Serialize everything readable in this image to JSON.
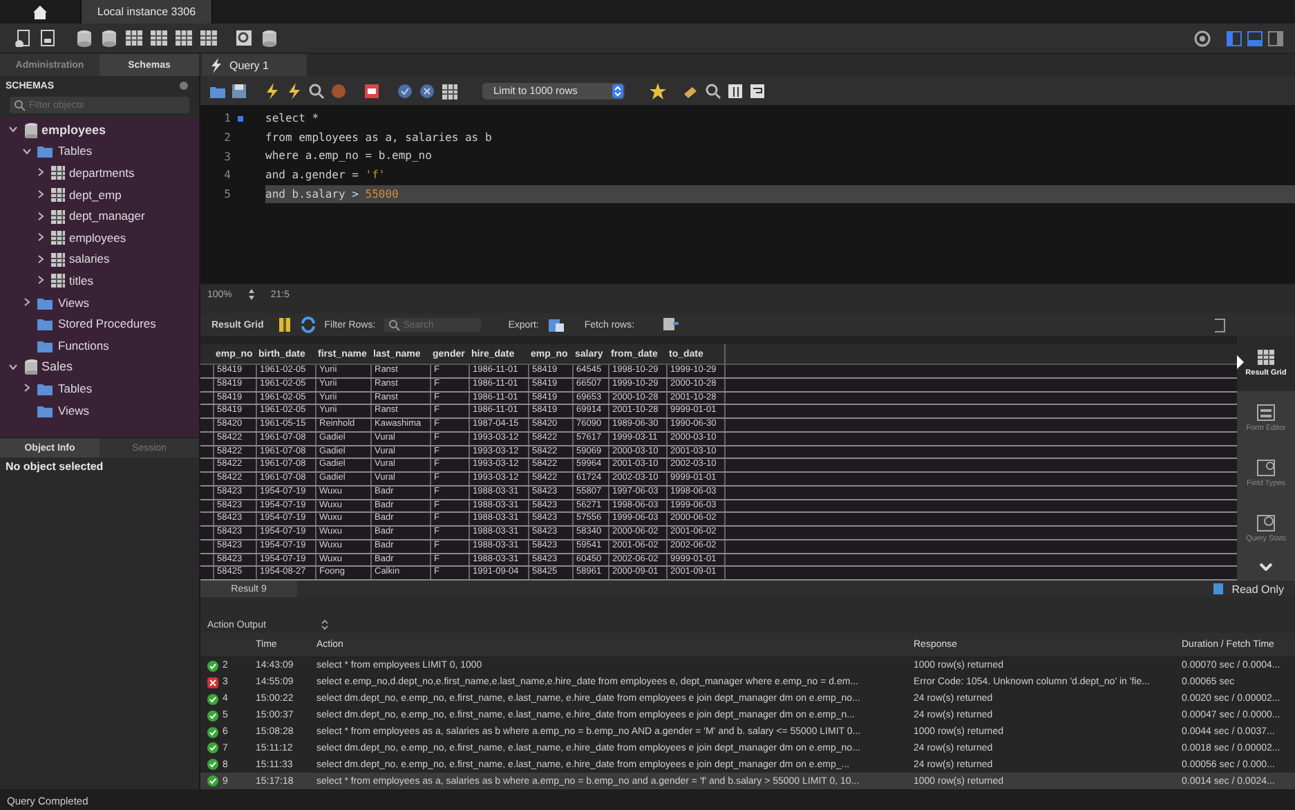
{
  "top_tabs": [
    {
      "label": "Local instance 3306",
      "selected": true
    }
  ],
  "sidebar": {
    "tabs": [
      {
        "label": "Administration",
        "selected": false
      },
      {
        "label": "Schemas",
        "selected": true
      }
    ],
    "title": "SCHEMAS",
    "filter": {
      "placeholder": "Filter objects"
    },
    "tree": [
      {
        "label": "employees",
        "kind": "schema",
        "default": true,
        "expanded": true,
        "children": [
          {
            "label": "Tables",
            "kind": "folder",
            "expanded": true,
            "children": [
              {
                "label": "departments",
                "kind": "table",
                "expanded": false
              },
              {
                "label": "dept_emp",
                "kind": "table",
                "expanded": false
              },
              {
                "label": "dept_manager",
                "kind": "table",
                "expanded": false
              },
              {
                "label": "employees",
                "kind": "table",
                "expanded": false
              },
              {
                "label": "salaries",
                "kind": "table",
                "expanded": false
              },
              {
                "label": "titles",
                "kind": "table",
                "expanded": false
              }
            ]
          },
          {
            "label": "Views",
            "kind": "folder",
            "expanded": false
          },
          {
            "label": "Stored Procedures",
            "kind": "folder"
          },
          {
            "label": "Functions",
            "kind": "folder"
          }
        ]
      },
      {
        "label": "Sales",
        "kind": "schema",
        "default": false,
        "expanded": true,
        "children": [
          {
            "label": "Tables",
            "kind": "folder",
            "expanded": false
          },
          {
            "label": "Views",
            "kind": "folder"
          }
        ]
      }
    ],
    "info_tabs": [
      {
        "label": "Object Info",
        "selected": true
      },
      {
        "label": "Session",
        "selected": false
      }
    ],
    "info_text": "No object selected"
  },
  "query_tabs": [
    {
      "label": "Query 1",
      "selected": true
    }
  ],
  "query_toolbar": {
    "limit": "Limit to 1000 rows"
  },
  "editor": {
    "lines": [
      {
        "number": "1",
        "marker": true,
        "current": false,
        "segments": [
          {
            "text": "select *",
            "kind": "plain"
          }
        ]
      },
      {
        "number": "2",
        "marker": false,
        "current": false,
        "segments": [
          {
            "text": "from employees as a, salaries as b",
            "kind": "plain"
          }
        ]
      },
      {
        "number": "3",
        "marker": false,
        "current": false,
        "segments": [
          {
            "text": "where a.emp_no = b.emp_no",
            "kind": "plain"
          }
        ]
      },
      {
        "number": "4",
        "marker": false,
        "current": false,
        "segments": [
          {
            "text": "and a.gender = ",
            "kind": "plain"
          },
          {
            "text": "'f'",
            "kind": "literal"
          }
        ]
      },
      {
        "number": "5",
        "marker": false,
        "current": true,
        "segments": [
          {
            "text": "and b.salary > ",
            "kind": "plain"
          },
          {
            "text": "55000",
            "kind": "literal"
          }
        ]
      }
    ],
    "zoom": "100%",
    "position": "21:5"
  },
  "result": {
    "toolbar": {
      "title": "Result Grid",
      "filter_label": "Filter Rows:",
      "search": {
        "placeholder": "Search"
      },
      "export_label": "Export:",
      "fetch_label": "Fetch rows:"
    },
    "columns": [
      "emp_no",
      "birth_date",
      "first_name",
      "last_name",
      "gender",
      "hire_date",
      "emp_no",
      "salary",
      "from_date",
      "to_date"
    ],
    "rows": [
      [
        "58419",
        "1961-02-05",
        "Yurii",
        "Ranst",
        "F",
        "1986-11-01",
        "58419",
        "64545",
        "1998-10-29",
        "1999-10-29"
      ],
      [
        "58419",
        "1961-02-05",
        "Yurii",
        "Ranst",
        "F",
        "1986-11-01",
        "58419",
        "66507",
        "1999-10-29",
        "2000-10-28"
      ],
      [
        "58419",
        "1961-02-05",
        "Yurii",
        "Ranst",
        "F",
        "1986-11-01",
        "58419",
        "69653",
        "2000-10-28",
        "2001-10-28"
      ],
      [
        "58419",
        "1961-02-05",
        "Yurii",
        "Ranst",
        "F",
        "1986-11-01",
        "58419",
        "69914",
        "2001-10-28",
        "9999-01-01"
      ],
      [
        "58420",
        "1961-05-15",
        "Reinhold",
        "Kawashima",
        "F",
        "1987-04-15",
        "58420",
        "76090",
        "1989-06-30",
        "1990-06-30"
      ],
      [
        "58422",
        "1961-07-08",
        "Gadiel",
        "Vural",
        "F",
        "1993-03-12",
        "58422",
        "57617",
        "1999-03-11",
        "2000-03-10"
      ],
      [
        "58422",
        "1961-07-08",
        "Gadiel",
        "Vural",
        "F",
        "1993-03-12",
        "58422",
        "59069",
        "2000-03-10",
        "2001-03-10"
      ],
      [
        "58422",
        "1961-07-08",
        "Gadiel",
        "Vural",
        "F",
        "1993-03-12",
        "58422",
        "59964",
        "2001-03-10",
        "2002-03-10"
      ],
      [
        "58422",
        "1961-07-08",
        "Gadiel",
        "Vural",
        "F",
        "1993-03-12",
        "58422",
        "61724",
        "2002-03-10",
        "9999-01-01"
      ],
      [
        "58423",
        "1954-07-19",
        "Wuxu",
        "Badr",
        "F",
        "1988-03-31",
        "58423",
        "55807",
        "1997-06-03",
        "1998-06-03"
      ],
      [
        "58423",
        "1954-07-19",
        "Wuxu",
        "Badr",
        "F",
        "1988-03-31",
        "58423",
        "56271",
        "1998-06-03",
        "1999-06-03"
      ],
      [
        "58423",
        "1954-07-19",
        "Wuxu",
        "Badr",
        "F",
        "1988-03-31",
        "58423",
        "57556",
        "1999-06-03",
        "2000-06-02"
      ],
      [
        "58423",
        "1954-07-19",
        "Wuxu",
        "Badr",
        "F",
        "1988-03-31",
        "58423",
        "58340",
        "2000-06-02",
        "2001-06-02"
      ],
      [
        "58423",
        "1954-07-19",
        "Wuxu",
        "Badr",
        "F",
        "1988-03-31",
        "58423",
        "59541",
        "2001-06-02",
        "2002-06-02"
      ],
      [
        "58423",
        "1954-07-19",
        "Wuxu",
        "Badr",
        "F",
        "1988-03-31",
        "58423",
        "60450",
        "2002-06-02",
        "9999-01-01"
      ],
      [
        "58425",
        "1954-08-27",
        "Foong",
        "Calkin",
        "F",
        "1991-09-04",
        "58425",
        "58961",
        "2000-09-01",
        "2001-09-01"
      ]
    ],
    "side_views": [
      {
        "label": "Result Grid",
        "selected": true
      },
      {
        "label": "Form Editor",
        "selected": false
      },
      {
        "label": "Field Types",
        "selected": false
      },
      {
        "label": "Query Stats",
        "selected": false
      }
    ],
    "tabs": [
      {
        "label": "Result 9",
        "selected": true
      }
    ],
    "read_only": "Read Only"
  },
  "output": {
    "selector": "Action Output",
    "columns": [
      "Time",
      "Action",
      "Response",
      "Duration / Fetch Time"
    ],
    "rows": [
      {
        "kind": "ok",
        "number": "2",
        "time": "14:43:09",
        "action": "select * from employees LIMIT 0, 1000",
        "response": "1000 row(s) returned",
        "duration": "0.00070 sec / 0.0004...",
        "selected": false
      },
      {
        "kind": "error",
        "number": "3",
        "time": "14:55:09",
        "action": "select e.emp_no,d.dept_no,e.first_name,e.last_name,e.hire_date from employees e, dept_manager where e.emp_no = d.em...",
        "response": "Error Code: 1054. Unknown column 'd.dept_no' in 'fie...",
        "duration": "0.00065 sec",
        "selected": false
      },
      {
        "kind": "ok",
        "number": "4",
        "time": "15:00:22",
        "action": "select dm.dept_no, e.emp_no, e.first_name, e.last_name, e.hire_date from employees e join dept_manager dm on e.emp_no...",
        "response": "24 row(s) returned",
        "duration": "0.0020 sec / 0.00002...",
        "selected": false
      },
      {
        "kind": "ok",
        "number": "5",
        "time": "15:00:37",
        "action": "select dm.dept_no, e.emp_no, e.first_name, e.last_name, e.hire_date  from employees e  join dept_manager dm on e.emp_n...",
        "response": "24 row(s) returned",
        "duration": "0.00047 sec / 0.0000...",
        "selected": false
      },
      {
        "kind": "ok",
        "number": "6",
        "time": "15:08:28",
        "action": "select * from employees as a, salaries as b where a.emp_no = b.emp_no AND a.gender = 'M' and b. salary <= 55000 LIMIT 0...",
        "response": "1000 row(s) returned",
        "duration": "0.0044 sec / 0.0037...",
        "selected": false
      },
      {
        "kind": "ok",
        "number": "7",
        "time": "15:11:12",
        "action": "select dm.dept_no, e.emp_no, e.first_name, e.last_name, e.hire_date from employees e join dept_manager dm on e.emp_no...",
        "response": "24 row(s) returned",
        "duration": "0.0018 sec / 0.00002...",
        "selected": false
      },
      {
        "kind": "ok",
        "number": "8",
        "time": "15:11:33",
        "action": "select dm.dept_no, e.emp_no, e.first_name, e.last_name, e.hire_date  from employees e  join dept_manager dm  on e.emp_...",
        "response": "24 row(s) returned",
        "duration": "0.00056 sec / 0.000...",
        "selected": false
      },
      {
        "kind": "ok",
        "number": "9",
        "time": "15:17:18",
        "action": "select * from employees as a, salaries as b where a.emp_no = b.emp_no and a.gender = 'f' and b.salary > 55000 LIMIT 0, 10...",
        "response": "1000 row(s) returned",
        "duration": "0.0014 sec / 0.0024...",
        "selected": true
      }
    ]
  },
  "status_bar": "Query Completed"
}
